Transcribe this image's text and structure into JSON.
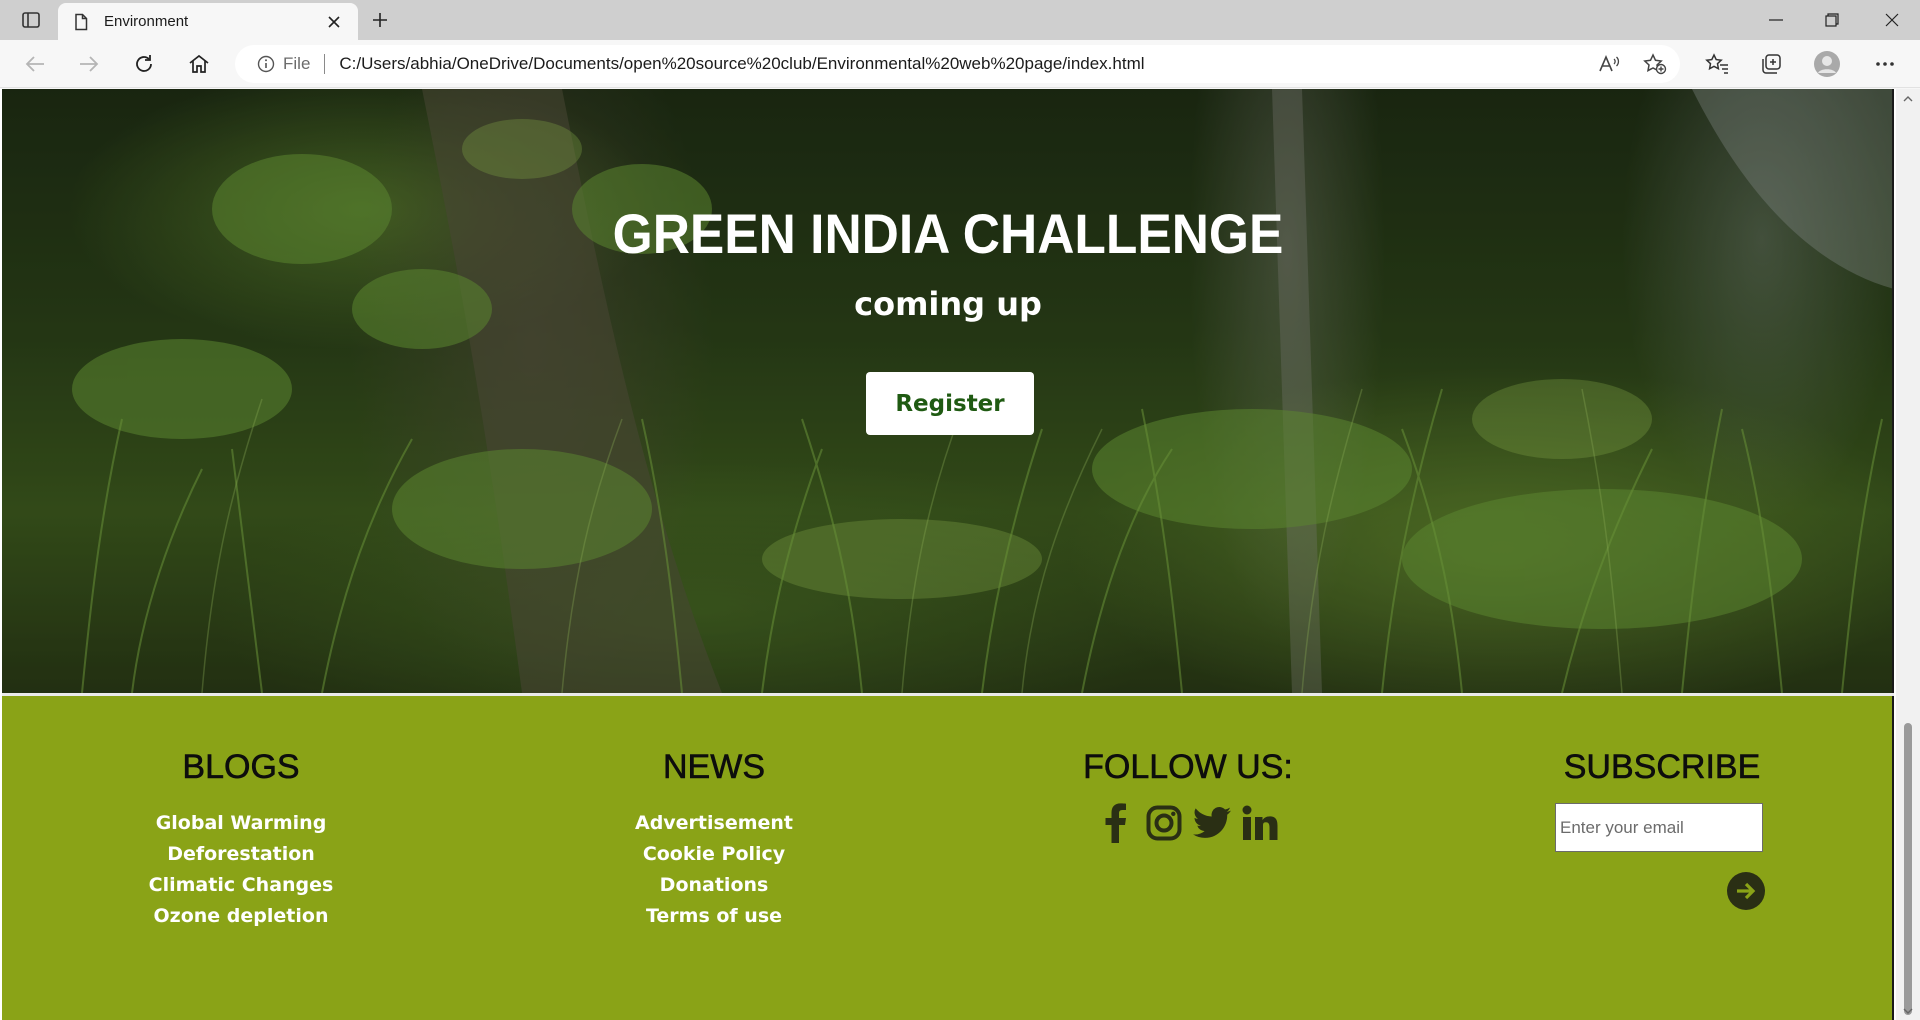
{
  "browser": {
    "tab_title": "Environment",
    "address_scheme": "File",
    "url": "C:/Users/abhia/OneDrive/Documents/open%20source%20club/Environmental%20web%20page/index.html"
  },
  "hero": {
    "title": "GREEN INDIA CHALLENGE",
    "subtitle": "coming up",
    "register_label": "Register"
  },
  "footer": {
    "blogs": {
      "heading": "BLOGS",
      "links": [
        "Global Warming",
        "Deforestation",
        "Climatic Changes",
        "Ozone depletion"
      ]
    },
    "news": {
      "heading": "NEWS",
      "links": [
        "Advertisement",
        "Cookie Policy",
        "Donations",
        "Terms of use"
      ]
    },
    "follow": {
      "heading": "FOLLOW US:",
      "icons": [
        "facebook-icon",
        "instagram-icon",
        "twitter-icon",
        "linkedin-icon"
      ]
    },
    "subscribe": {
      "heading": "SUBSCRIBE",
      "email_placeholder": "Enter your email"
    }
  },
  "colors": {
    "footer_bg": "#8aa317",
    "register_text": "#1f5a12",
    "icon_dark": "#2a2f14"
  }
}
